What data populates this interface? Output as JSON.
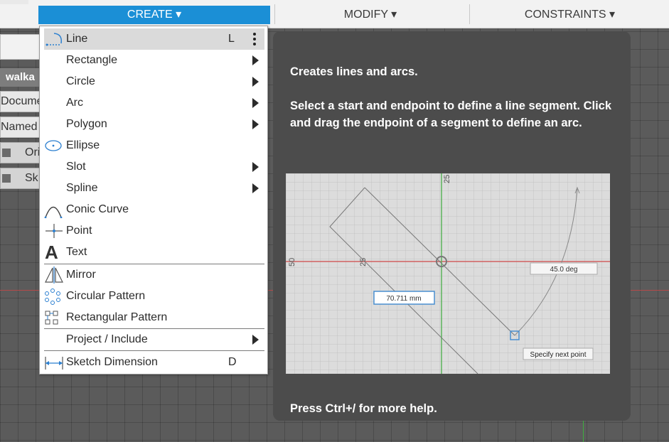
{
  "toolbar": {
    "tabs": [
      {
        "label": "CREATE ▾"
      },
      {
        "label": "MODIFY ▾"
      },
      {
        "label": "CONSTRAINTS ▾"
      }
    ]
  },
  "browser": {
    "title": "walka",
    "rows": [
      "Docume",
      "Named"
    ],
    "subitems": [
      "Ori",
      "Sk"
    ]
  },
  "menu": {
    "items": [
      {
        "label": "Line",
        "shortcut": "L",
        "icon": "line-icon",
        "submenu": false,
        "highlighted": true
      },
      {
        "label": "Rectangle",
        "icon": "",
        "submenu": true
      },
      {
        "label": "Circle",
        "icon": "",
        "submenu": true
      },
      {
        "label": "Arc",
        "icon": "",
        "submenu": true
      },
      {
        "label": "Polygon",
        "icon": "",
        "submenu": true
      },
      {
        "label": "Ellipse",
        "icon": "ellipse-icon",
        "submenu": false
      },
      {
        "label": "Slot",
        "icon": "",
        "submenu": true
      },
      {
        "label": "Spline",
        "icon": "",
        "submenu": true
      },
      {
        "label": "Conic Curve",
        "icon": "conic-curve-icon",
        "submenu": false
      },
      {
        "label": "Point",
        "icon": "point-icon",
        "submenu": false
      },
      {
        "label": "Text",
        "icon": "text-icon",
        "submenu": false
      },
      {
        "label": "Mirror",
        "icon": "mirror-icon",
        "submenu": false
      },
      {
        "label": "Circular Pattern",
        "icon": "circular-pattern-icon",
        "submenu": false
      },
      {
        "label": "Rectangular Pattern",
        "icon": "rectangular-pattern-icon",
        "submenu": false
      },
      {
        "label": "Project / Include",
        "icon": "",
        "submenu": true
      },
      {
        "label": "Sketch Dimension",
        "shortcut": "D",
        "icon": "sketch-dimension-icon",
        "submenu": false
      }
    ]
  },
  "tooltip": {
    "line1": "Creates lines and arcs.",
    "line2": "Select a start and endpoint to define a line segment. Click and drag the endpoint of a segment to define an arc.",
    "footer": "Press Ctrl+/ for more help.",
    "image": {
      "tick_top": "25",
      "tick_mid": "25",
      "tick_left": "50",
      "length_label": "70.711 mm",
      "angle_label": "45.0 deg",
      "prompt": "Specify next point"
    }
  },
  "colors": {
    "accent": "#1b8fd6",
    "tooltip_bg": "#4c4c4c",
    "highlight": "#dadada"
  }
}
